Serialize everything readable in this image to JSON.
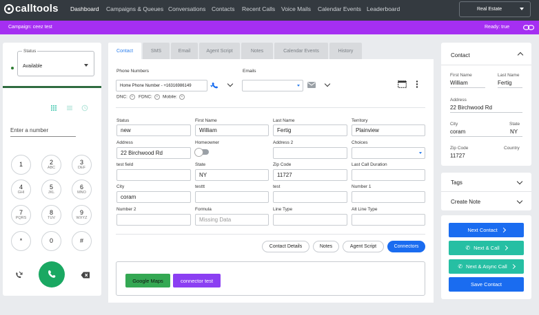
{
  "brand": {
    "name": "calltools"
  },
  "nav": {
    "items": [
      "Dashboard",
      "Campaigns & Queues",
      "Conversations",
      "Contacts",
      "Recent Calls",
      "Voice Mails",
      "Calendar Events",
      "Leaderboard"
    ],
    "account_select": "Real Estate"
  },
  "campaign_bar": {
    "campaign": "Campaign: ceez test",
    "ready": "Ready: true"
  },
  "dialer": {
    "status_label": "Status",
    "status_value": "Available",
    "number_placeholder": "Enter a number",
    "keys": [
      {
        "d": "1",
        "l": ""
      },
      {
        "d": "2",
        "l": "ABC"
      },
      {
        "d": "3",
        "l": "DEF"
      },
      {
        "d": "4",
        "l": "GHI"
      },
      {
        "d": "5",
        "l": "JKL"
      },
      {
        "d": "6",
        "l": "MNO"
      },
      {
        "d": "7",
        "l": "PQRS"
      },
      {
        "d": "8",
        "l": "TUV"
      },
      {
        "d": "9",
        "l": "WXYZ"
      },
      {
        "d": "*",
        "l": ""
      },
      {
        "d": "0",
        "l": ""
      },
      {
        "d": "#",
        "l": ""
      }
    ]
  },
  "tabs": [
    "Contact",
    "SMS",
    "Email",
    "Agent Script",
    "Notes",
    "Calendar Events",
    "History"
  ],
  "contact_form": {
    "phone_label": "Phone Numbers",
    "phone_value": "Home Phone Number - +16316986149",
    "emails_label": "Emails",
    "flags": [
      "DNC:",
      "FDNC:",
      "Mobile:"
    ],
    "fields": {
      "status": {
        "label": "Status",
        "value": "new"
      },
      "first_name": {
        "label": "First Name",
        "value": "William"
      },
      "last_name": {
        "label": "Last Name",
        "value": "Fertig"
      },
      "territory": {
        "label": "Territory",
        "value": "Plainview"
      },
      "address": {
        "label": "Address",
        "value": "22  Birchwood Rd"
      },
      "homeowner": {
        "label": "Homeowner"
      },
      "address2": {
        "label": "Address 2",
        "value": ""
      },
      "choices": {
        "label": "Choices",
        "value": ""
      },
      "test_field": {
        "label": "test field",
        "value": ""
      },
      "state": {
        "label": "State",
        "value": "NY"
      },
      "zip": {
        "label": "Zip Code",
        "value": "11727"
      },
      "last_call_duration": {
        "label": "Last Call Duration",
        "value": ""
      },
      "city": {
        "label": "City",
        "value": "coram"
      },
      "testtt": {
        "label": "testtt",
        "value": ""
      },
      "test": {
        "label": "test",
        "value": ""
      },
      "number1": {
        "label": "Number 1",
        "value": ""
      },
      "number2": {
        "label": "Number 2",
        "value": ""
      },
      "formula": {
        "label": "Formula",
        "value": "Missing Data"
      },
      "line_type": {
        "label": "Line Type",
        "value": ""
      },
      "alt_line_type": {
        "label": "Alt Line Type",
        "value": ""
      }
    },
    "pills": [
      "Contact Details",
      "Notes",
      "Agent Script",
      "Connectors"
    ],
    "connectors": [
      "Google Maps",
      "connector test"
    ]
  },
  "contact_summary": {
    "title": "Contact",
    "first_name_label": "First Name",
    "first_name": "William",
    "last_name_label": "Last Name",
    "last_name": "Fertig",
    "address_label": "Address",
    "address": "22 Birchwood Rd",
    "city_label": "City",
    "city": "coram",
    "state_label": "State",
    "state": "NY",
    "zip_label": "Zip Code",
    "zip": "11727",
    "country_label": "Country"
  },
  "tags_title": "Tags",
  "create_note_title": "Create Note",
  "actions": {
    "next_contact": "Next Contact",
    "next_call": "Next & Call",
    "next_async_call": "Next & Async Call",
    "save_contact": "Save Contact"
  },
  "colors": {
    "nav_bg": "#343a40",
    "campaign_bar": "#a52ff2",
    "primary_blue": "#1a6cf0",
    "teal": "#26bfa3",
    "call_green": "#1aa862",
    "maps_green": "#34a853",
    "connector_purple": "#8b3ff2"
  }
}
